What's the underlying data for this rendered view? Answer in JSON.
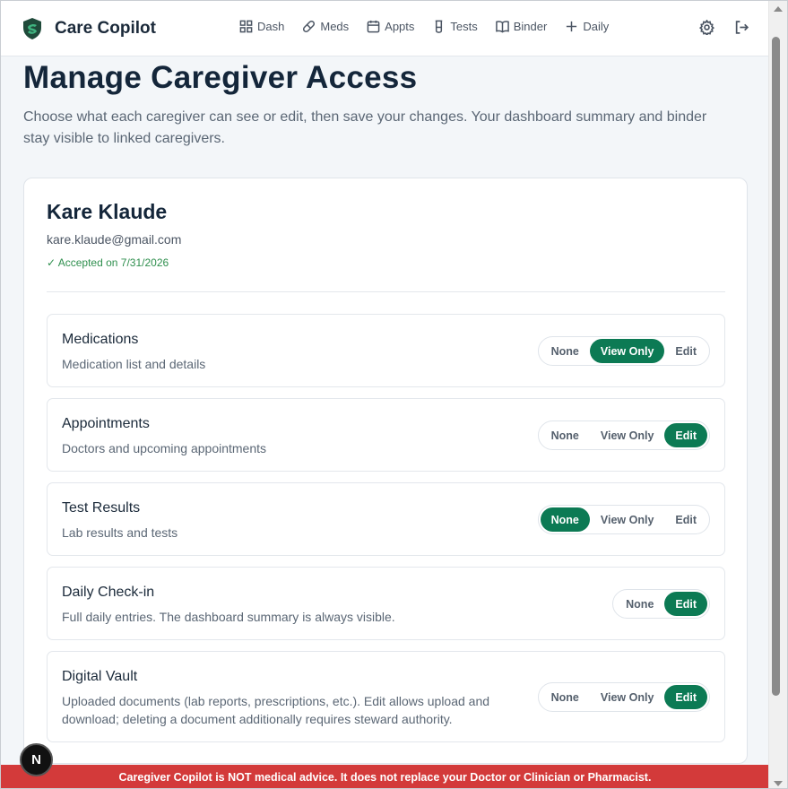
{
  "brand": {
    "name": "Care Copilot",
    "accent": "#0c7a54"
  },
  "nav": [
    {
      "label": "Dash",
      "icon": "grid-icon"
    },
    {
      "label": "Meds",
      "icon": "pill-icon"
    },
    {
      "label": "Appts",
      "icon": "calendar-icon"
    },
    {
      "label": "Tests",
      "icon": "test-tube-icon"
    },
    {
      "label": "Binder",
      "icon": "book-icon"
    },
    {
      "label": "Daily",
      "icon": "plus-icon"
    }
  ],
  "page": {
    "title": "Manage Caregiver Access",
    "subtitle": "Choose what each caregiver can see or edit, then save your changes. Your dashboard summary and binder stay visible to linked caregivers."
  },
  "caregiver": {
    "name": "Kare Klaude",
    "email": "kare.klaude@gmail.com",
    "status": "✓ Accepted on 7/31/2026"
  },
  "permissions": [
    {
      "title": "Medications",
      "description": "Medication list and details",
      "options": [
        "None",
        "View Only",
        "Edit"
      ],
      "selected": "View Only"
    },
    {
      "title": "Appointments",
      "description": "Doctors and upcoming appointments",
      "options": [
        "None",
        "View Only",
        "Edit"
      ],
      "selected": "Edit"
    },
    {
      "title": "Test Results",
      "description": "Lab results and tests",
      "options": [
        "None",
        "View Only",
        "Edit"
      ],
      "selected": "None"
    },
    {
      "title": "Daily Check-in",
      "description": "Full daily entries. The dashboard summary is always visible.",
      "options": [
        "None",
        "Edit"
      ],
      "selected": "Edit"
    },
    {
      "title": "Digital Vault",
      "description": "Uploaded documents (lab reports, prescriptions, etc.). Edit allows upload and download; deleting a document additionally requires steward authority.",
      "options": [
        "None",
        "View Only",
        "Edit"
      ],
      "selected": "Edit"
    }
  ],
  "banner": {
    "text": "Caregiver Copilot is NOT medical advice. It does not replace your Doctor or Clinician or Pharmacist.",
    "color": "#d33a3a"
  },
  "badge": {
    "label": "N"
  }
}
